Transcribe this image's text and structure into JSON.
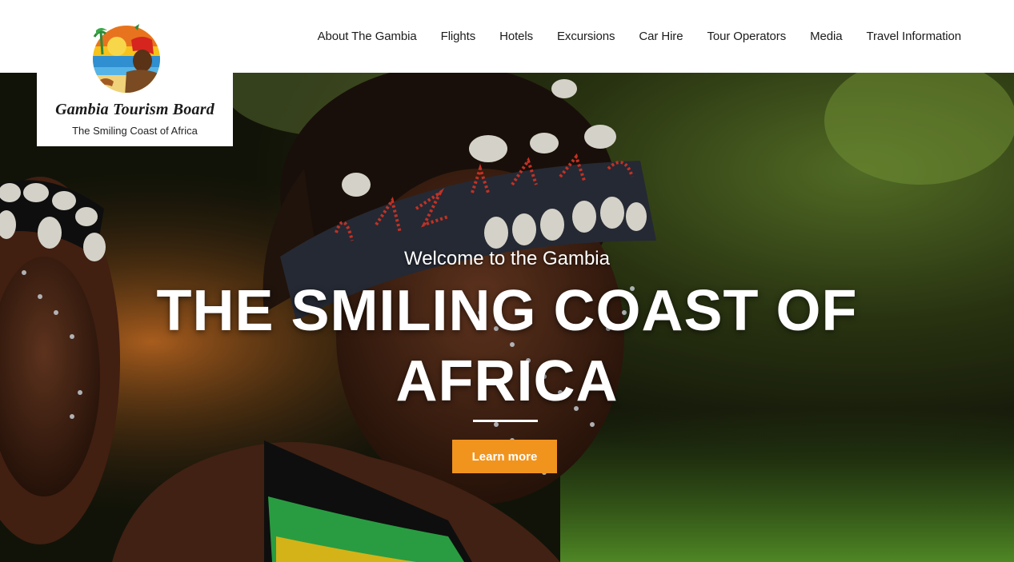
{
  "logo": {
    "name": "Gambia Tourism Board",
    "tagline": "The Smiling Coast of Africa"
  },
  "nav": {
    "items": [
      {
        "label": "About The Gambia"
      },
      {
        "label": "Flights"
      },
      {
        "label": "Hotels"
      },
      {
        "label": "Excursions"
      },
      {
        "label": "Car Hire"
      },
      {
        "label": "Tour Operators"
      },
      {
        "label": "Media"
      },
      {
        "label": "Travel Information"
      }
    ]
  },
  "hero": {
    "welcome": "Welcome to the Gambia",
    "headline": "THE SMILING COAST OF AFRICA",
    "cta_label": "Learn more"
  },
  "colors": {
    "accent": "#f1941e",
    "header_bg": "#ffffff",
    "nav_text": "#1c1c1c"
  }
}
